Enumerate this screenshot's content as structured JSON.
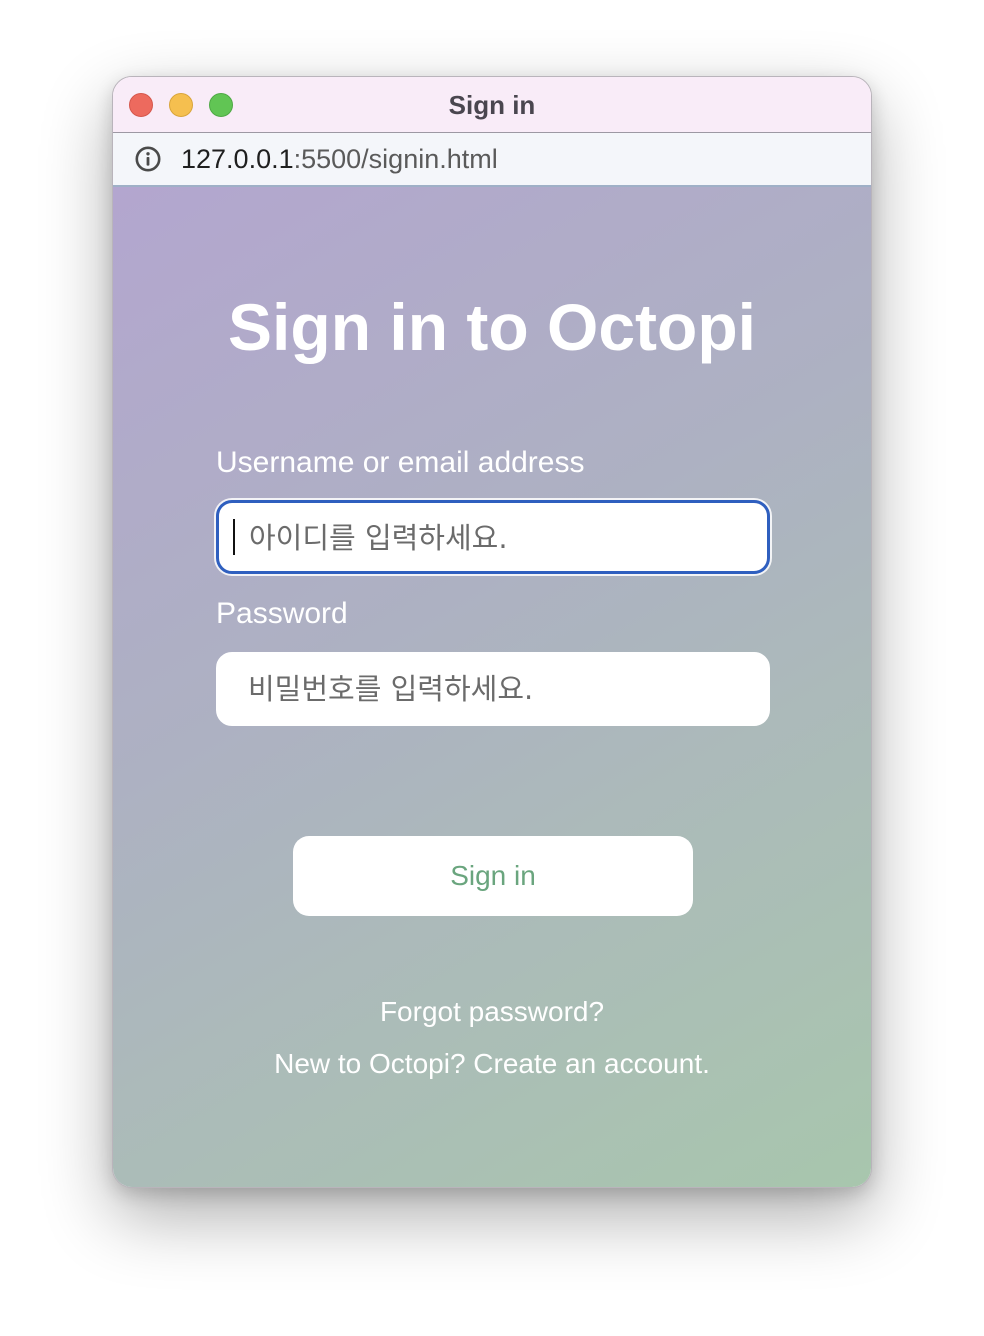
{
  "window": {
    "title": "Sign in"
  },
  "address_bar": {
    "host": "127.0.0.1",
    "rest": ":5500/signin.html",
    "icon": "info-icon"
  },
  "page": {
    "heading": "Sign in to Octopi",
    "username": {
      "label": "Username or email address",
      "placeholder": "아이디를 입력하세요."
    },
    "password": {
      "label": "Password",
      "placeholder": "비밀번호를 입력하세요."
    },
    "sign_in_button": "Sign in",
    "forgot_password_link": "Forgot password?",
    "create_account_link": "New to Octopi? Create an account."
  },
  "colors": {
    "focus_ring": "#2f5fbf",
    "button_text": "#6aa57e",
    "gradient_start": "#b3a6cf",
    "gradient_end": "#a8c6ad"
  }
}
